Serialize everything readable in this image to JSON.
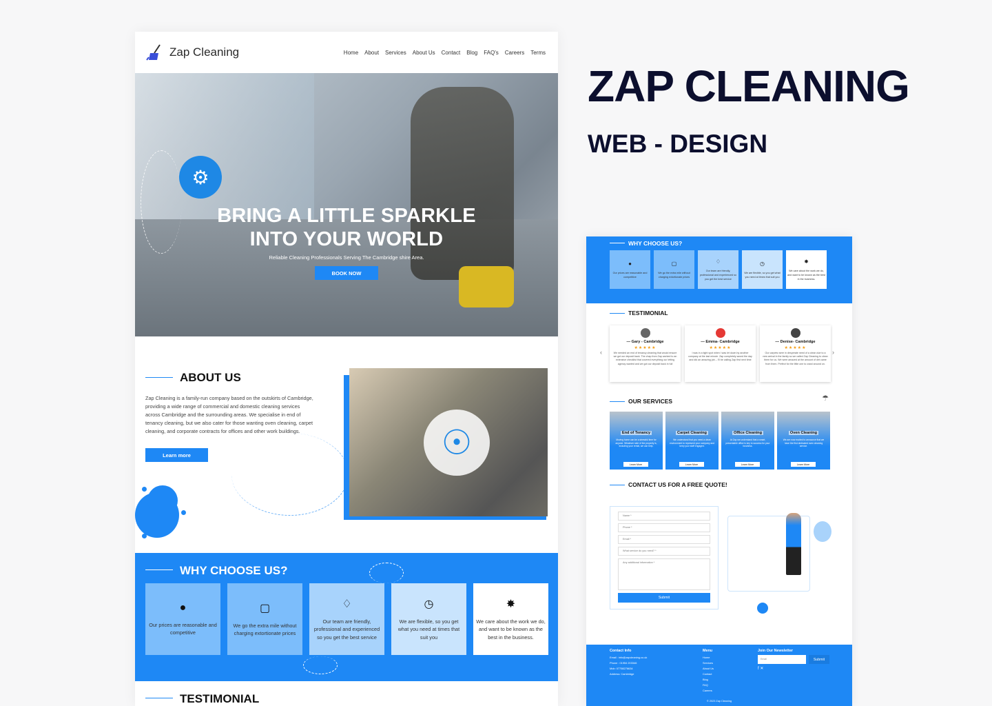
{
  "presentation": {
    "title": "ZAP CLEANING",
    "subtitle": "WEB - DESIGN"
  },
  "site": {
    "brand": "Zap Cleaning",
    "menu": [
      "Home",
      "About",
      "Services",
      "About Us",
      "Contact",
      "Blog",
      "FAQ's",
      "Careers",
      "Terms"
    ],
    "hero": {
      "headline_1": "BRING A LITTLE SPARKLE",
      "headline_2": "INTO YOUR WORLD",
      "subtext": "Reliable Cleaning Professionals Serving The Cambridge shire Area.",
      "button": "BOOK NOW"
    },
    "about": {
      "heading": "ABOUT US",
      "body": "Zap Cleaning is a family-run company based on the outskirts of Cambridge, providing a wide range of commercial and domestic cleaning services across Cambridge and the surrounding areas. We specialise in end of tenancy cleaning, but we also cater for those wanting oven cleaning, carpet cleaning, and corporate contracts for offices and other work buildings.",
      "button": "Learn more"
    },
    "why": {
      "heading": "WHY CHOOSE US?",
      "cards": [
        {
          "icon": "money-hand-icon",
          "text": "Our prices are reasonable and competitive"
        },
        {
          "icon": "wallet-icon",
          "text": "We go the extra mile without charging extortionate prices"
        },
        {
          "icon": "team-icon",
          "text": "Our team are friendly, professional and experienced so you get the best service"
        },
        {
          "icon": "clock-hand-icon",
          "text": "We are flexible, so you get what you need at times that suit you"
        },
        {
          "icon": "network-icon",
          "text": "We care about the work we do, and want to be known as the best in the business."
        }
      ]
    },
    "testimonial_heading": "TESTIMONIAL"
  },
  "right_page": {
    "why_heading": "WHY CHOOSE US?",
    "why_cards": [
      "Our prices are reasonable and competitive",
      "We go the extra mile without charging extortionate prices",
      "Our team are friendly, professional and experienced so you get the best service",
      "We are flexible, so you get what you need at times that suit you",
      "We care about the work we do, and want to be known as the best in the business."
    ],
    "testimonial_heading": "TESTIMONIAL",
    "testimonials": [
      {
        "name": "— Gary - Cambridge",
        "stars": "★★★★★",
        "quote": "We needed an end of tenancy cleaning that would ensure we got our deposit back. The chap from Zap worked to an extensive checklist that covered everything our letting agency wanted and we got our deposit back in full"
      },
      {
        "name": "— Emma- Cambridge",
        "stars": "★★★★★",
        "quote": "I was in a tight spot when I was let down by another company at the last minute. Zap completely saved the day and did an amazing job – I'll be calling Zap first next time"
      },
      {
        "name": "— Denise- Cambridge",
        "stars": "★★★★★",
        "quote": "Our carpets were in desperate need of a clean due to a new arrival in the family so we called Zap Cleaning to clean them for us. We were amazed at the amount of dirt came from them. Perfect for the little one to crawl around on."
      }
    ],
    "services_heading": "OUR SERVICES",
    "services": [
      {
        "name": "End of Tenancy",
        "desc": "Moving home can be a stressful time for anyone. Whatever side of the property is, including your rental, we can help.",
        "button": "Learn More"
      },
      {
        "name": "Carpet Cleaning",
        "desc": "We understand that you need a clean environment to represent your company and keep your staff engaged.",
        "button": "Learn More"
      },
      {
        "name": "Office Cleaning",
        "desc": "At Zap we understand that a smart, presentable office is key to success for your business.",
        "button": "Learn More"
      },
      {
        "name": "Oven Cleaning",
        "desc": "We are now excited to announce that we have the first dedicated oven cleaning service.",
        "button": "Learn More"
      }
    ],
    "contact_heading": "CONTACT US FOR A FREE QUOTE!",
    "form": {
      "name": "Name *",
      "phone": "Phone *",
      "email": "Email *",
      "service": "What service do you need? *",
      "info": "Any additional information *",
      "submit": "Submit"
    },
    "footer": {
      "contact_heading": "Contact Info",
      "contact_lines": [
        "Email : info@zapcleaning.co.uk",
        "Phone : 01954 203346",
        "Mob: 07758276634",
        "Address: Cambridge"
      ],
      "menu_heading": "Menu",
      "menu_items": [
        "Home",
        "Services",
        "About Us",
        "Contact",
        "Blog",
        "FAQ",
        "Careers"
      ],
      "newsletter_heading": "Join Our Newsletter",
      "newsletter_placeholder": "Email",
      "newsletter_button": "Submit",
      "copyright": "© 2023 Zap Cleaning"
    }
  }
}
